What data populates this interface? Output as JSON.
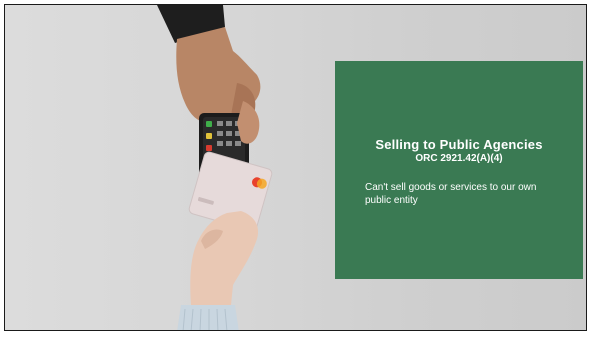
{
  "slide": {
    "title": "Selling to Public Agencies",
    "subtitle": "ORC 2921.42(A)(4)",
    "body": "Can't sell goods or services to our own public entity"
  },
  "photo": {
    "description_icons": [
      "payment-terminal-icon",
      "credit-card-icon"
    ]
  },
  "colors": {
    "panel": "#3a7a53",
    "background": "#d4d4d4"
  }
}
